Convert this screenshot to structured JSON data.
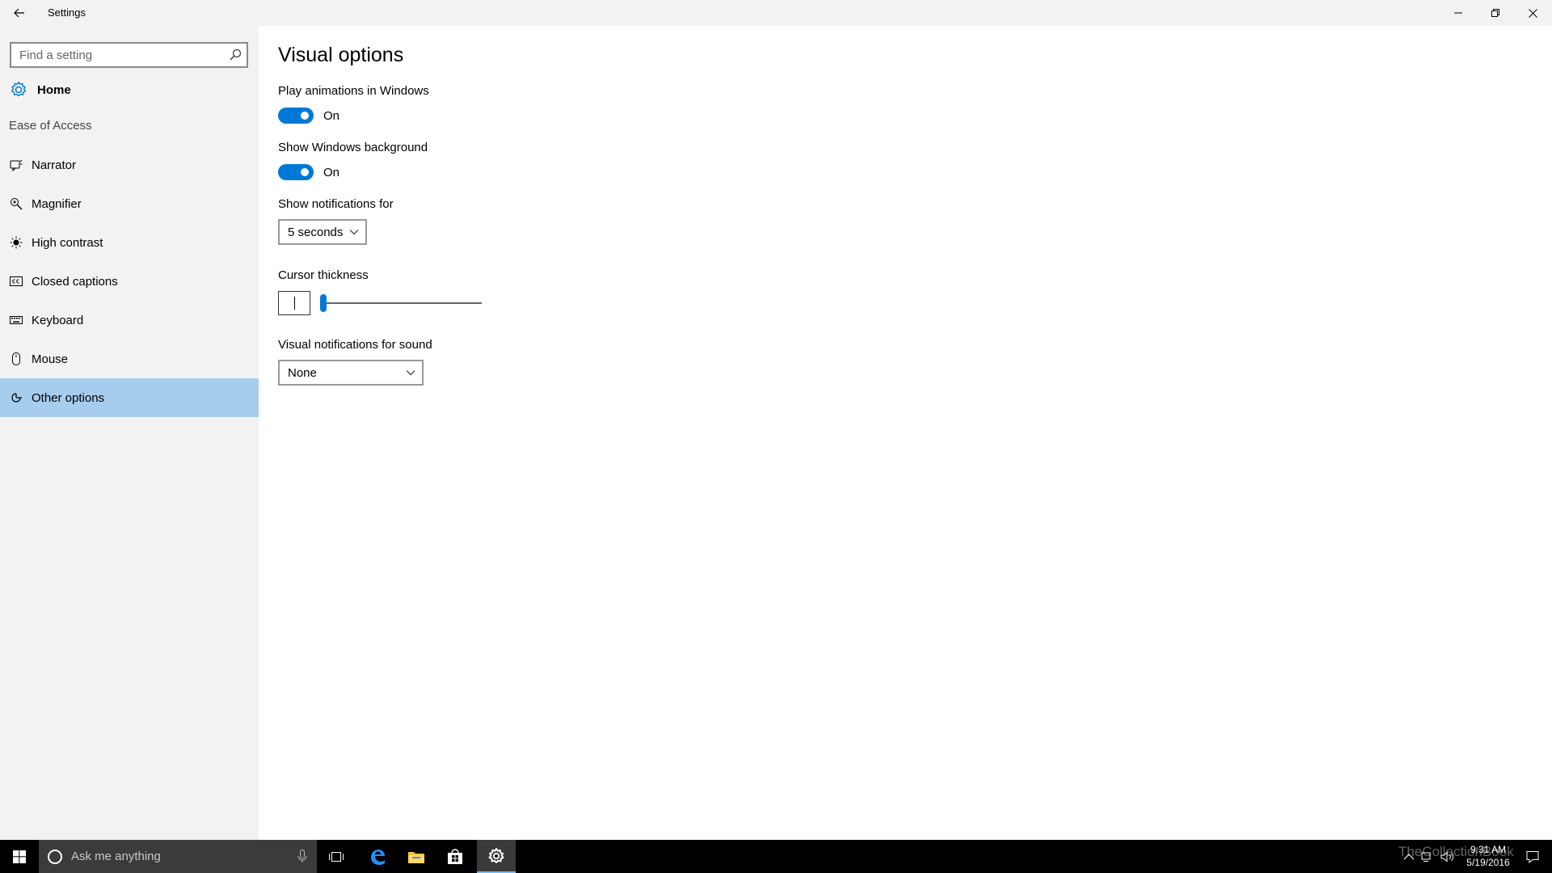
{
  "window": {
    "title": "Settings"
  },
  "sidebar": {
    "search_placeholder": "Find a setting",
    "home_label": "Home",
    "section_heading": "Ease of Access",
    "items": [
      {
        "label": "Narrator",
        "icon": "narrator-icon"
      },
      {
        "label": "Magnifier",
        "icon": "magnifier-icon"
      },
      {
        "label": "High contrast",
        "icon": "high-contrast-icon"
      },
      {
        "label": "Closed captions",
        "icon": "closed-captions-icon"
      },
      {
        "label": "Keyboard",
        "icon": "keyboard-icon"
      },
      {
        "label": "Mouse",
        "icon": "mouse-icon"
      },
      {
        "label": "Other options",
        "icon": "other-options-icon",
        "selected": true
      }
    ]
  },
  "main": {
    "title": "Visual options",
    "animations": {
      "label": "Play animations in Windows",
      "state": "On",
      "on": true
    },
    "background": {
      "label": "Show Windows background",
      "state": "On",
      "on": true
    },
    "notifications": {
      "label": "Show notifications for",
      "value": "5 seconds"
    },
    "cursor": {
      "label": "Cursor thickness",
      "value_fraction": 0.0
    },
    "sound": {
      "label": "Visual notifications for sound",
      "value": "None"
    }
  },
  "taskbar": {
    "search_placeholder": "Ask me anything",
    "time": "9:31 AM",
    "date": "5/19/2016",
    "watermark": "TheCollectionBook"
  },
  "colors": {
    "accent": "#0078d7",
    "selected_bg": "#a6cdee",
    "sidebar_bg": "#f2f2f2"
  }
}
